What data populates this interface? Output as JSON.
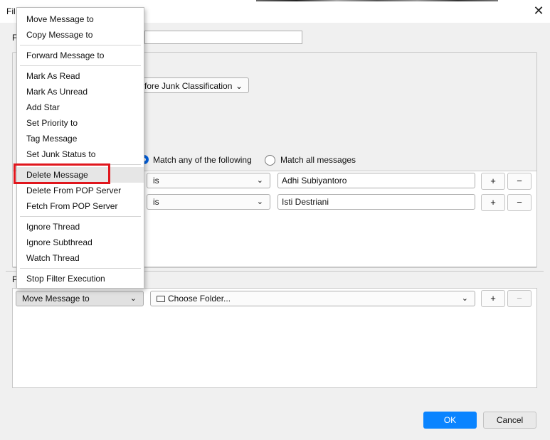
{
  "window": {
    "title_fragment": "Fil",
    "close_glyph": "✕"
  },
  "filter": {
    "name_label_fragment": "F",
    "name_value": ""
  },
  "junk": {
    "label": "fore Junk Classification"
  },
  "match": {
    "any_label": "Match any of the following",
    "all_label": "Match all messages",
    "selected": "any"
  },
  "rules": [
    {
      "op": "is",
      "value": "Adhi Subiyantoro",
      "add": "+",
      "remove": "−"
    },
    {
      "op": "is",
      "value": "Isti Destriani",
      "add": "+",
      "remove": "−"
    }
  ],
  "actions_label_fragment": "P",
  "action": {
    "selected": "Move Message to",
    "folder": "Choose Folder...",
    "add": "+",
    "remove": "−"
  },
  "buttons": {
    "ok": "OK",
    "cancel": "Cancel"
  },
  "menu": {
    "items": [
      "Move Message to",
      "Copy Message to",
      "Forward Message to",
      "Mark As Read",
      "Mark As Unread",
      "Add Star",
      "Set Priority to",
      "Tag Message",
      "Set Junk Status to",
      "Delete Message",
      "Delete From POP Server",
      "Fetch From POP Server",
      "Ignore Thread",
      "Ignore Subthread",
      "Watch Thread",
      "Stop Filter Execution"
    ],
    "highlighted": "Delete Message"
  },
  "icons": {
    "chevron": "chevron-down-icon",
    "folder": "folder-icon"
  },
  "colors": {
    "accent": "#0a84ff",
    "highlight": "#e0161d"
  }
}
